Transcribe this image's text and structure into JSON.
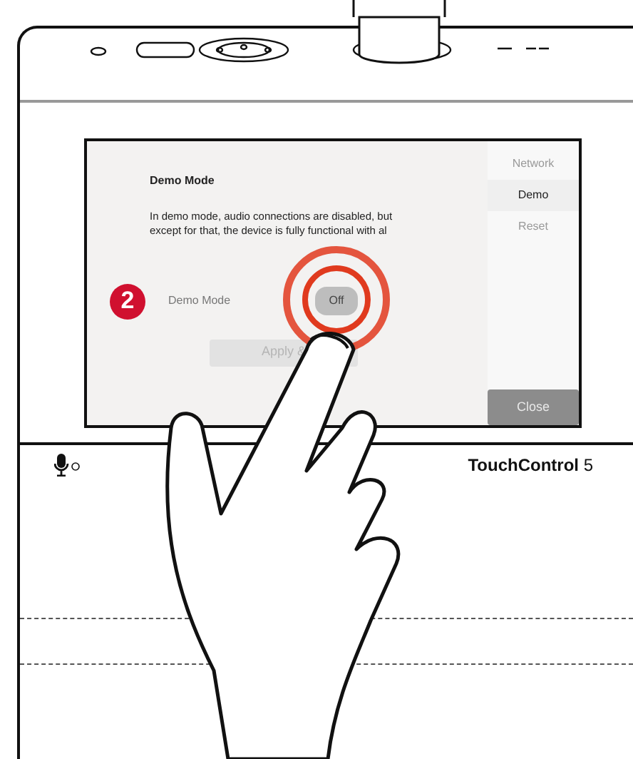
{
  "screen": {
    "title": "Demo Mode",
    "description_lines": [
      "In demo mode, audio connections are disabled, but",
      "except for that, the device is fully functional with al"
    ],
    "step_number": "2",
    "setting_label": "Demo Mode",
    "toggle": {
      "label": "Off",
      "on": false
    },
    "apply_button": {
      "label": "Apply &",
      "disabled": true
    },
    "nav": [
      {
        "label": "Network",
        "selected": false
      },
      {
        "label": "Demo",
        "selected": true
      },
      {
        "label": "Reset",
        "selected": false
      }
    ],
    "close_button": "Close"
  },
  "device": {
    "name": "**TouchControl** 5"
  }
}
